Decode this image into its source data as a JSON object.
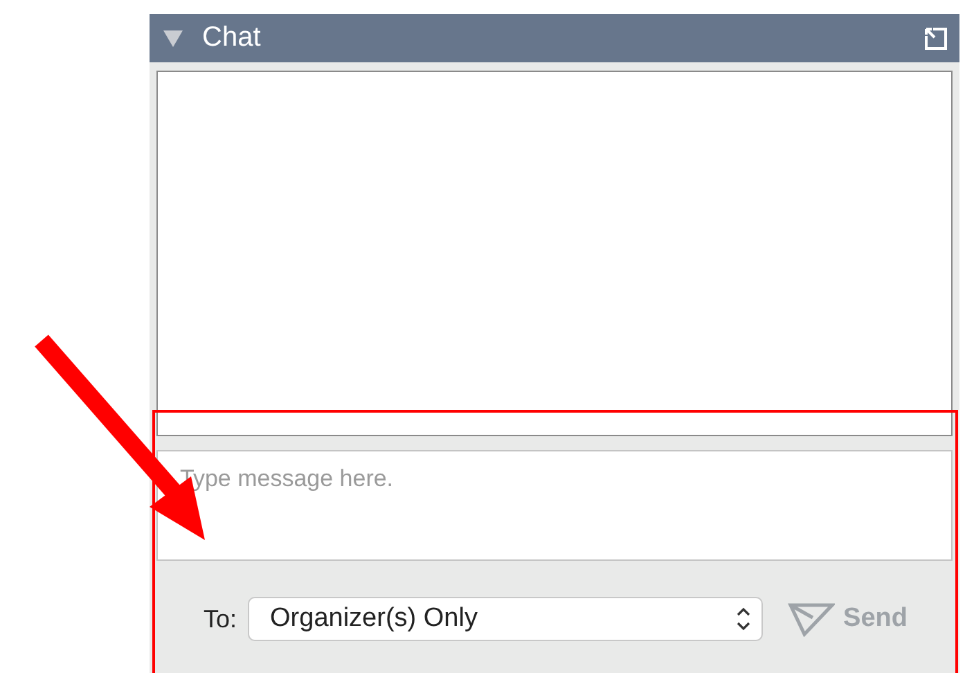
{
  "panel": {
    "title": "Chat",
    "expanded": true
  },
  "message_input": {
    "placeholder": "Type message here."
  },
  "recipient": {
    "label": "To:",
    "value": "Organizer(s) Only"
  },
  "send_button": {
    "label": "Send",
    "disabled": true
  }
}
